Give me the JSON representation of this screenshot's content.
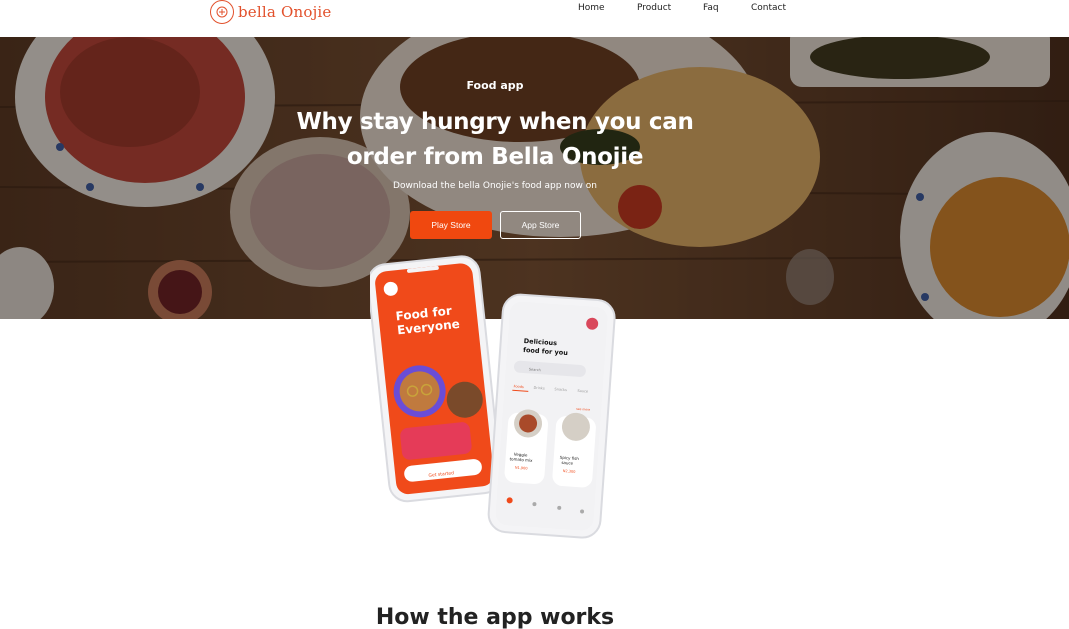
{
  "header": {
    "brand": "bella Onojie",
    "nav": [
      {
        "label": "Home"
      },
      {
        "label": "Product"
      },
      {
        "label": "Faq"
      },
      {
        "label": "Contact"
      }
    ]
  },
  "hero": {
    "eyebrow": "Food app",
    "headline": "Why stay hungry when you can order from Bella Onojie",
    "subline": "Download the bella Onojie's food app now on",
    "buttons": {
      "play_store": "Play Store",
      "app_store": "App Store"
    }
  },
  "phone_left": {
    "title": "Food for Everyone",
    "cta": "Get started"
  },
  "phone_right": {
    "title": "Delicious food for you",
    "search_placeholder": "Search",
    "tabs": [
      "Foods",
      "Drinks",
      "Snacks",
      "Sauce"
    ],
    "see_more": "see more",
    "cards": [
      {
        "name": "Veggie tomato mix",
        "price": "N1,900"
      },
      {
        "name": "Spicy fish sauce",
        "price": "N2,300"
      }
    ]
  },
  "section": {
    "title": "How the app works"
  },
  "colors": {
    "accent": "#f0480f",
    "brand": "#e2512c"
  }
}
